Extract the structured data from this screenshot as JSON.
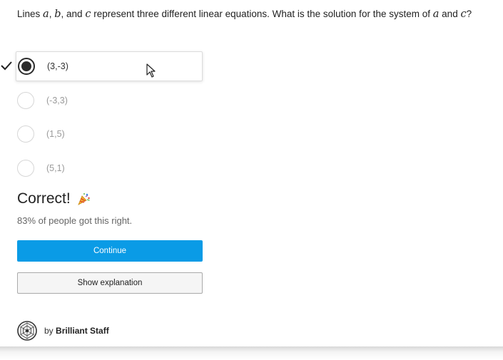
{
  "question": {
    "prefix": "Lines",
    "var_a": "a",
    "sep1": ",",
    "var_b": "b",
    "sep2": ", and",
    "var_c": "c",
    "middle": "represent three different linear equations. What is the solution for the system of",
    "var_a2": "a",
    "and": "and",
    "var_c2": "c",
    "end": "?"
  },
  "options": [
    {
      "label": "(3,-3)",
      "selected": true
    },
    {
      "label": "(-3,3)",
      "selected": false
    },
    {
      "label": "(1,5)",
      "selected": false
    },
    {
      "label": "(5,1)",
      "selected": false
    }
  ],
  "result": {
    "title": "Correct!",
    "stats": "83% of people got this right."
  },
  "buttons": {
    "continue": "Continue",
    "explanation": "Show explanation"
  },
  "author": {
    "by": "by",
    "name": "Brilliant Staff"
  },
  "colors": {
    "primary": "#0a9be6",
    "selected_radio": "#2b2b2b"
  },
  "icons": {
    "selected_mark": "check-icon",
    "result": "party-popper-icon",
    "pointer": "cursor-icon",
    "avatar": "brilliant-logo-icon"
  }
}
